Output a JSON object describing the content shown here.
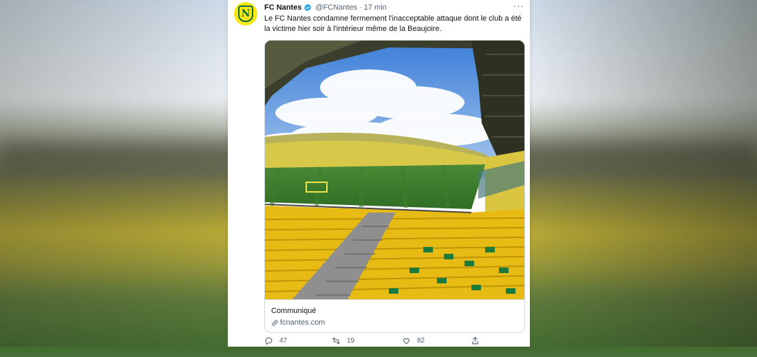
{
  "tweet": {
    "display_name": "FC Nantes",
    "handle": "@FCNantes",
    "separator": "·",
    "time": "17 min",
    "more": "···",
    "text": "Le FC Nantes condamne fermement l'inacceptable attaque dont le club a été la victime hier soir à l'intérieur même de la Beaujoire.",
    "avatar_text": "N",
    "card": {
      "title": "Communiqué",
      "domain": "fcnantes.com"
    },
    "actions": {
      "replies": "47",
      "retweets": "19",
      "likes": "82"
    }
  },
  "icons": {
    "verified": "verified-badge-icon",
    "more": "more-dots-icon",
    "link": "link-icon",
    "reply": "reply-icon",
    "retweet": "retweet-icon",
    "like": "heart-icon",
    "share": "share-icon"
  },
  "colors": {
    "club_yellow": "#f7e716",
    "club_green": "#0a6b3a",
    "verified_blue": "#1d9bf0",
    "text_primary": "#0f1419",
    "text_secondary": "#536471"
  }
}
